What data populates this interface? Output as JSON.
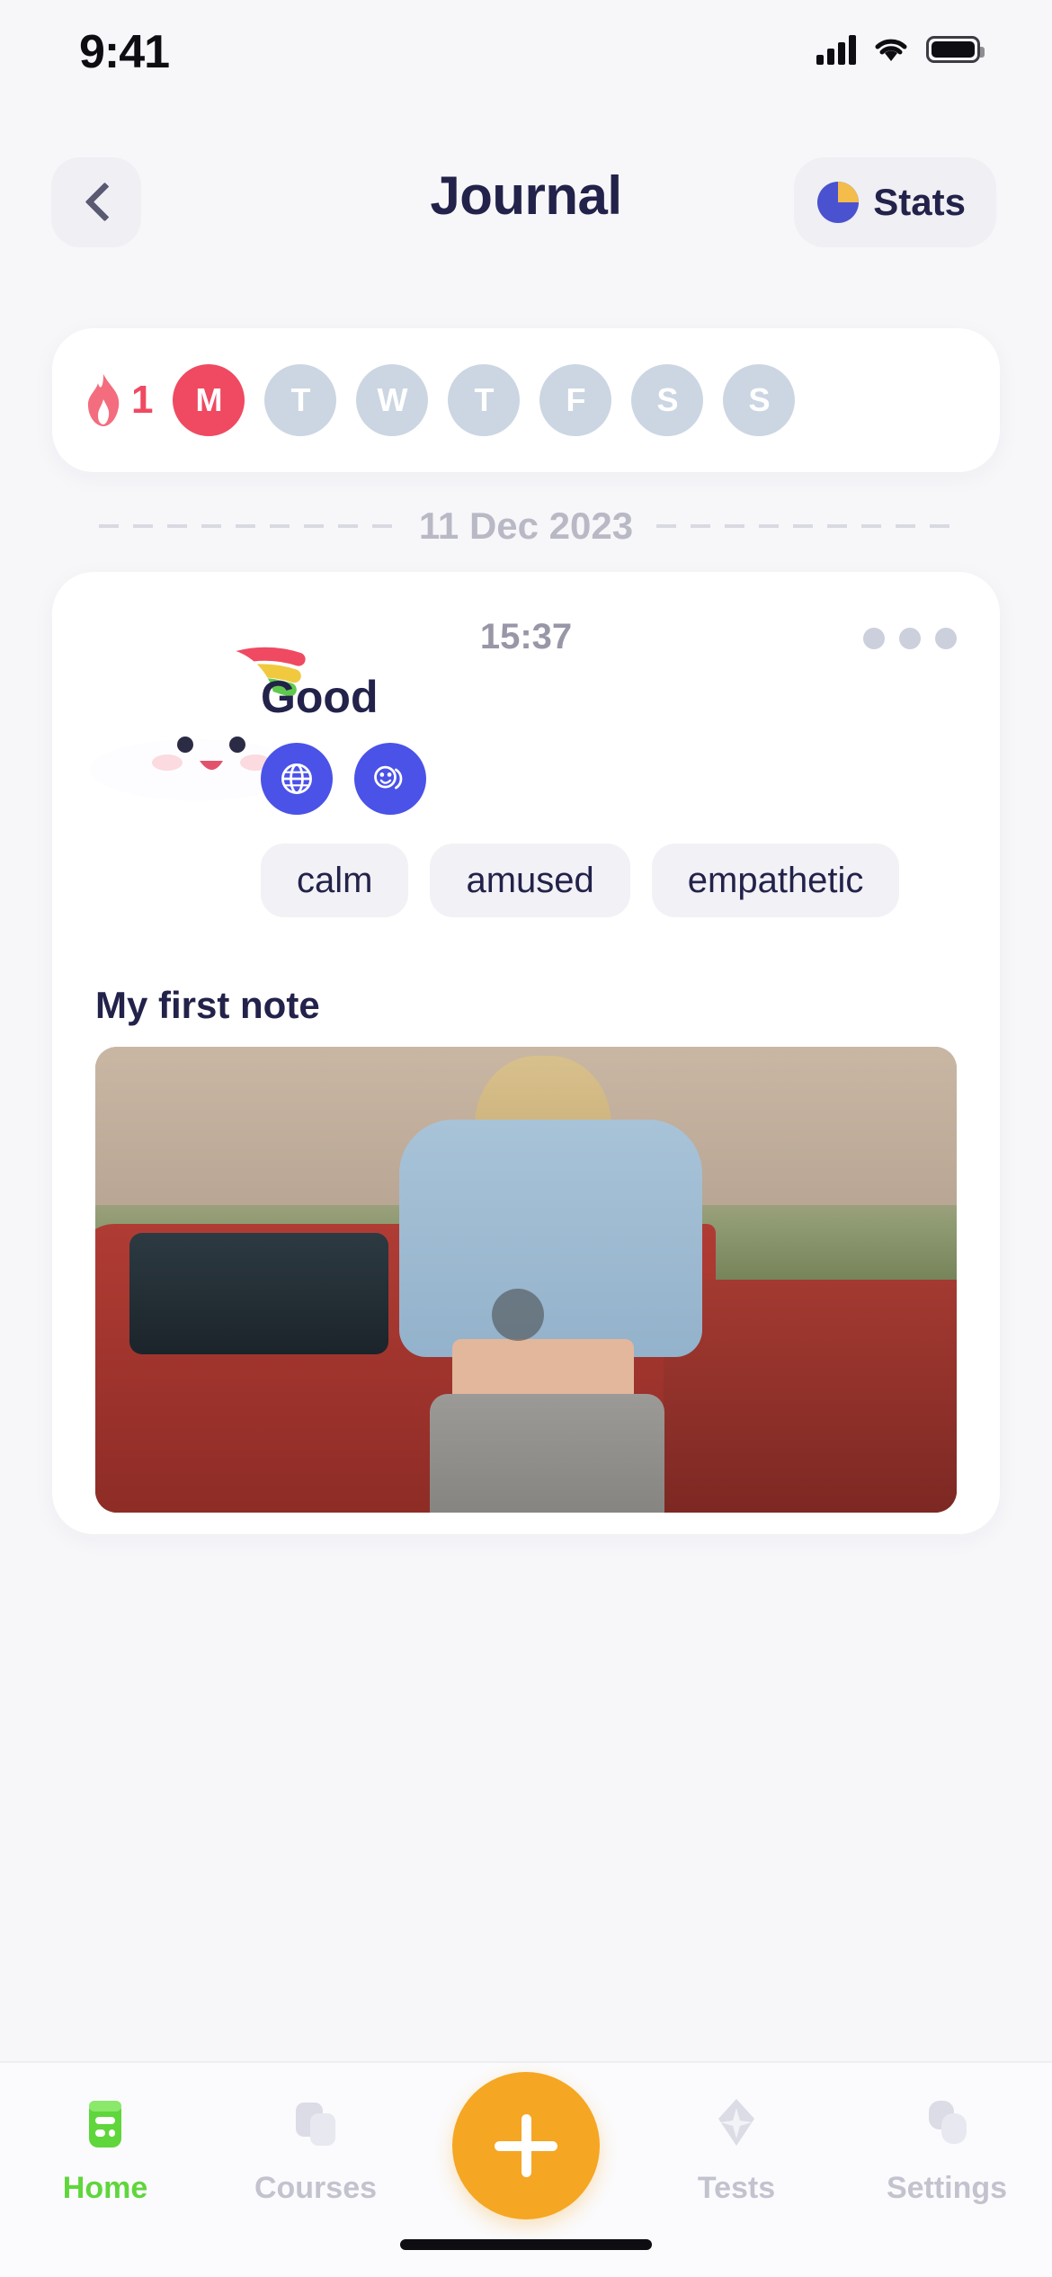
{
  "status_bar": {
    "time": "9:41",
    "signal_icon": "cellular-signal-icon",
    "wifi_icon": "wifi-icon",
    "battery_icon": "battery-full-icon"
  },
  "header": {
    "back_icon": "chevron-left-icon",
    "title": "Journal",
    "stats_label": "Stats",
    "stats_icon": "pie-chart-icon",
    "title_color": "#22224a",
    "chip_bg": "#efeff4"
  },
  "streak": {
    "flame_icon": "flame-icon",
    "count": "1",
    "active_color": "#ef4a61",
    "inactive_color": "#ccd6e2",
    "days": [
      {
        "letter": "M",
        "active": true
      },
      {
        "letter": "T",
        "active": false
      },
      {
        "letter": "W",
        "active": false
      },
      {
        "letter": "T",
        "active": false
      },
      {
        "letter": "F",
        "active": false
      },
      {
        "letter": "S",
        "active": false
      },
      {
        "letter": "S",
        "active": false
      }
    ]
  },
  "date_divider": {
    "label": "11 Dec 2023"
  },
  "entry": {
    "time": "15:37",
    "mood": "Good",
    "mascot_icon": "cloud-rainbow-icon",
    "menu_icon": "more-dots-icon",
    "badges": [
      {
        "icon": "globe-icon"
      },
      {
        "icon": "people-icon"
      }
    ],
    "badge_color": "#4a52e8",
    "tags": [
      "calm",
      "amused",
      "empathetic"
    ],
    "note_title": "My first note",
    "photo_alt": "photo-woman-blue-sweater-red-car"
  },
  "tabbar": {
    "items": [
      {
        "label": "Home",
        "icon": "home-book-icon",
        "active": true
      },
      {
        "label": "Courses",
        "icon": "courses-cards-icon",
        "active": false
      },
      {
        "label": "Tests",
        "icon": "tests-sparkle-icon",
        "active": false
      },
      {
        "label": "Settings",
        "icon": "settings-shapes-icon",
        "active": false
      }
    ],
    "fab_icon": "plus-icon",
    "fab_color": "#f5a623",
    "active_color": "#5fd63c",
    "inactive_color": "#c3c3cf"
  }
}
